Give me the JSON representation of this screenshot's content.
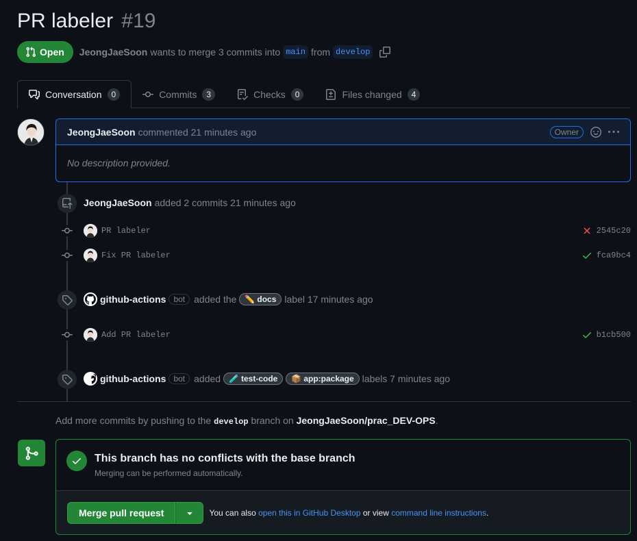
{
  "pr": {
    "title": "PR labeler",
    "number": "#19",
    "state": "Open",
    "author": "JeongJaeSoon",
    "merge_text_1": "wants to merge 3 commits into",
    "base_branch": "main",
    "merge_text_2": "from",
    "head_branch": "develop"
  },
  "tabs": [
    {
      "label": "Conversation",
      "count": "0"
    },
    {
      "label": "Commits",
      "count": "3"
    },
    {
      "label": "Checks",
      "count": "0"
    },
    {
      "label": "Files changed",
      "count": "4"
    }
  ],
  "comment": {
    "author": "JeongJaeSoon",
    "action": "commented 21 minutes ago",
    "badge": "Owner",
    "body": "No description provided."
  },
  "timeline": {
    "commits_event": {
      "actor": "JeongJaeSoon",
      "text": "added 2 commits 21 minutes ago"
    },
    "commits": [
      {
        "message": "PR labeler",
        "sha": "2545c20",
        "status": "failure"
      },
      {
        "message": "Fix PR labeler",
        "sha": "fca9bc4",
        "status": "success"
      },
      {
        "message": "Add PR labeler",
        "sha": "b1cb500",
        "status": "success"
      }
    ],
    "label_event_1": {
      "actor": "github-actions",
      "bot": "bot",
      "text_before": "added the",
      "label": "docs",
      "label_emoji": "✏️",
      "text_after": "label 17 minutes ago"
    },
    "label_event_2": {
      "actor": "github-actions",
      "bot": "bot",
      "text_before": "added",
      "label_a": "test-code",
      "label_a_emoji": "🧪",
      "label_b": "app:package",
      "label_b_emoji": "📦",
      "text_after": "labels 7 minutes ago"
    }
  },
  "push_hint": {
    "before": "Add more commits by pushing to the",
    "branch": "develop",
    "middle": "branch on",
    "repo": "JeongJaeSoon/prac_DEV-OPS",
    "end": "."
  },
  "merge": {
    "title": "This branch has no conflicts with the base branch",
    "subtitle": "Merging can be performed automatically.",
    "button": "Merge pull request",
    "hint_before": "You can also",
    "link_desktop": "open this in GitHub Desktop",
    "hint_middle": "or view",
    "link_cli": "command line instructions",
    "hint_end": "."
  },
  "colors": {
    "accent_green": "#238636",
    "accent_blue": "#1f6feb",
    "failure_red": "#f85149",
    "success_green": "#3fb950",
    "background": "#0d1117"
  }
}
